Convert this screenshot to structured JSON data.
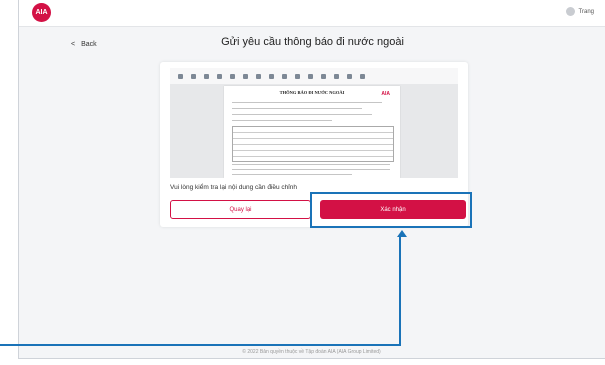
{
  "app": {
    "logo_text": "AIA"
  },
  "user": {
    "name": "Trang",
    "icon": "user-avatar-icon"
  },
  "nav": {
    "back_label": "Back",
    "back_icon": "chevron-left-icon"
  },
  "page": {
    "title": "Gửi yêu cầu thông báo đi nước ngoài"
  },
  "document": {
    "title": "THÔNG BÁO ĐI NƯỚC NGOÀI",
    "logo_text": "AIA"
  },
  "form": {
    "hint": "Vui lòng kiểm tra lại nội dung cần điều chỉnh",
    "back_button": "Quay lại",
    "confirm_button": "Xác nhận"
  },
  "footer": {
    "copyright": "© 2022 Bản quyền thuộc về Tập đoàn AIA (AIA Group Limited)"
  },
  "colors": {
    "brand": "#d31145",
    "annotation": "#1a73b8"
  }
}
